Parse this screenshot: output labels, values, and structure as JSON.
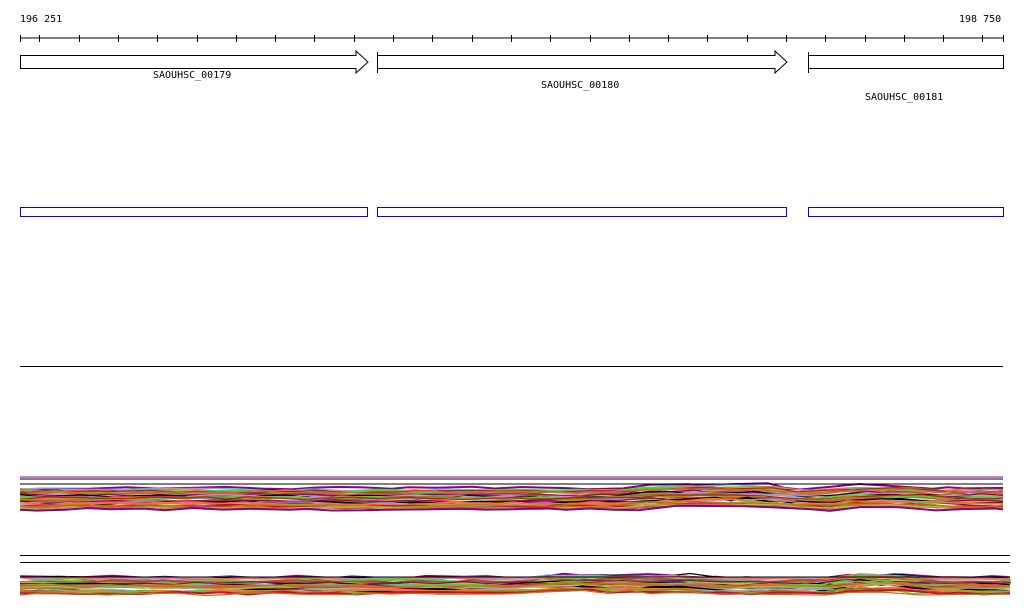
{
  "ruler": {
    "start_label": "196 251",
    "end_label": "198 750"
  },
  "genes": [
    {
      "name": "SAOUHSC_00179",
      "direction": "forward"
    },
    {
      "name": "SAOUHSC_00180",
      "direction": "forward"
    },
    {
      "name": "SAOUHSC_00181",
      "direction": "forward"
    }
  ],
  "colors": {
    "gene_outline": "#000000",
    "feature_box": "#0000ff",
    "traces": [
      "#8b008b",
      "#000000",
      "#6cb4f0",
      "#c090c0",
      "#ff6a3c",
      "#808000",
      "#32e032",
      "#c8102e",
      "#d2691e",
      "#a0522d",
      "#b8860b",
      "#cd5c5c",
      "#9acd32"
    ]
  }
}
